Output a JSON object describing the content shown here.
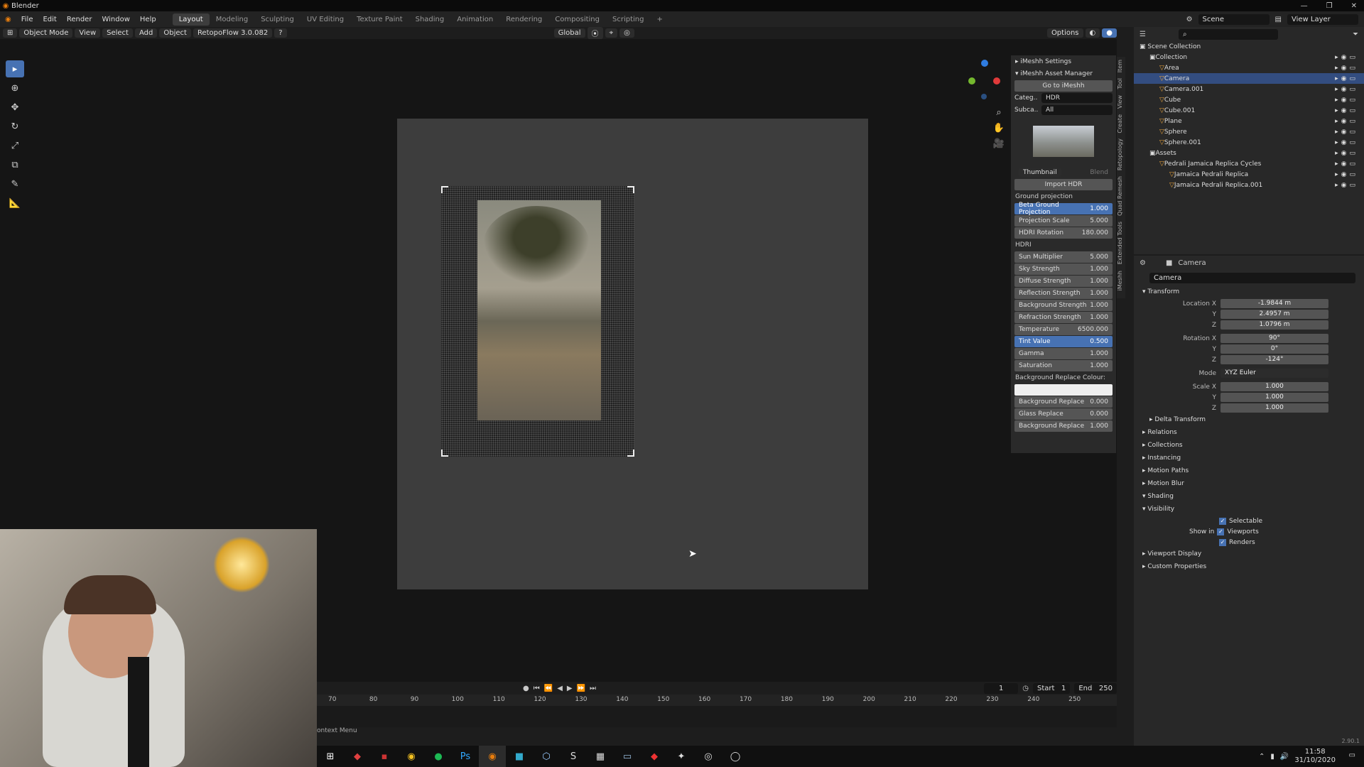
{
  "window": {
    "title": "Blender"
  },
  "menu": {
    "items": [
      "File",
      "Edit",
      "Render",
      "Window",
      "Help"
    ],
    "workspaces": [
      "Layout",
      "Modeling",
      "Sculpting",
      "UV Editing",
      "Texture Paint",
      "Shading",
      "Animation",
      "Rendering",
      "Compositing",
      "Scripting"
    ],
    "active_workspace": "Layout",
    "scene": "Scene",
    "view_layer": "View Layer"
  },
  "viewport_header": {
    "mode": "Object Mode",
    "view": "View",
    "select": "Select",
    "add": "Add",
    "object": "Object",
    "addon": "RetopoFlow 3.0.082",
    "transform_orientation": "Global",
    "options": "Options"
  },
  "imesh": {
    "settings": "iMeshh Settings",
    "asset_manager": "iMeshh Asset Manager",
    "go_to": "Go to iMeshh",
    "category_label": "Categ..",
    "category_value": "HDR",
    "subcategory_label": "Subca..",
    "subcategory_value": "All",
    "thumbnail_tab": "Thumbnail",
    "blend_tab": "Blend",
    "import_hdr": "Import HDR",
    "ground_projection": "Ground projection",
    "gp_rows": [
      {
        "label": "Beta Ground Projection",
        "value": "1.000",
        "active": true
      },
      {
        "label": "Projection Scale",
        "value": "5.000",
        "active": false
      },
      {
        "label": "HDRI Rotation",
        "value": "180.000",
        "active": false
      }
    ],
    "hdri_label": "HDRI",
    "hdri_rows": [
      {
        "label": "Sun Multiplier",
        "value": "5.000",
        "active": false
      },
      {
        "label": "Sky Strength",
        "value": "1.000",
        "active": false
      },
      {
        "label": "Diffuse Strength",
        "value": "1.000",
        "active": false
      },
      {
        "label": "Reflection Strength",
        "value": "1.000",
        "active": false
      },
      {
        "label": "Background Strength",
        "value": "1.000",
        "active": false
      },
      {
        "label": "Refraction Strength",
        "value": "1.000",
        "active": false
      },
      {
        "label": "Temperature",
        "value": "6500.000",
        "active": false
      },
      {
        "label": "Tint Value",
        "value": "0.500",
        "active": true
      },
      {
        "label": "Gamma",
        "value": "1.000",
        "active": false
      },
      {
        "label": "Saturation",
        "value": "1.000",
        "active": false
      }
    ],
    "bg_replace_colour": "Background Replace Colour:",
    "bg_rows": [
      {
        "label": "Background Replace",
        "value": "0.000"
      },
      {
        "label": "Glass Replace",
        "value": "0.000"
      },
      {
        "label": "Background Replace",
        "value": "1.000"
      }
    ]
  },
  "side_tabs": [
    "Item",
    "Tool",
    "View",
    "Create",
    "Retopology",
    "Quad Remesh",
    "Extended Tools",
    "iMeshh"
  ],
  "outliner": {
    "root": "Scene Collection",
    "rows": [
      {
        "label": "Collection",
        "indent": 1,
        "selected": false
      },
      {
        "label": "Area",
        "indent": 2,
        "selected": false
      },
      {
        "label": "Camera",
        "indent": 2,
        "selected": true
      },
      {
        "label": "Camera.001",
        "indent": 2,
        "selected": false
      },
      {
        "label": "Cube",
        "indent": 2,
        "selected": false
      },
      {
        "label": "Cube.001",
        "indent": 2,
        "selected": false
      },
      {
        "label": "Plane",
        "indent": 2,
        "selected": false
      },
      {
        "label": "Sphere",
        "indent": 2,
        "selected": false
      },
      {
        "label": "Sphere.001",
        "indent": 2,
        "selected": false
      },
      {
        "label": "Assets",
        "indent": 1,
        "selected": false
      },
      {
        "label": "Pedrali Jamaica Replica Cycles",
        "indent": 2,
        "selected": false
      },
      {
        "label": "Jamaica Pedrali Replica",
        "indent": 3,
        "selected": false
      },
      {
        "label": "Jamaica Pedrali Replica.001",
        "indent": 3,
        "selected": false
      }
    ]
  },
  "properties": {
    "object": "Camera",
    "object_name": "Camera",
    "transform": "Transform",
    "location": {
      "label": "Location X",
      "x": "-1.9844 m",
      "y": "2.4957 m",
      "z": "1.0796 m"
    },
    "rotation": {
      "label": "Rotation X",
      "x": "90°",
      "y": "0°",
      "z": "-124°"
    },
    "mode_label": "Mode",
    "mode_value": "XYZ Euler",
    "scale": {
      "label": "Scale X",
      "x": "1.000",
      "y": "1.000",
      "z": "1.000"
    },
    "axis_y": "Y",
    "axis_z": "Z",
    "delta": "Delta Transform",
    "sections": [
      "Relations",
      "Collections",
      "Instancing",
      "Motion Paths",
      "Motion Blur",
      "Shading",
      "Visibility"
    ],
    "selectable": "Selectable",
    "show_in": "Show in",
    "viewports": "Viewports",
    "renders": "Renders",
    "sections2": [
      "Viewport Display",
      "Custom Properties"
    ],
    "version": "2.90.1"
  },
  "timeline": {
    "current_frame": "1",
    "start_label": "Start",
    "start": "1",
    "end_label": "End",
    "end": "250",
    "ticks": [
      "70",
      "80",
      "90",
      "100",
      "110",
      "120",
      "130",
      "140",
      "150",
      "160",
      "170",
      "180",
      "190",
      "200",
      "210",
      "220",
      "230",
      "240",
      "250"
    ],
    "status": "ontext Menu"
  },
  "taskbar": {
    "time": "11:58",
    "date": "31/10/2020"
  }
}
